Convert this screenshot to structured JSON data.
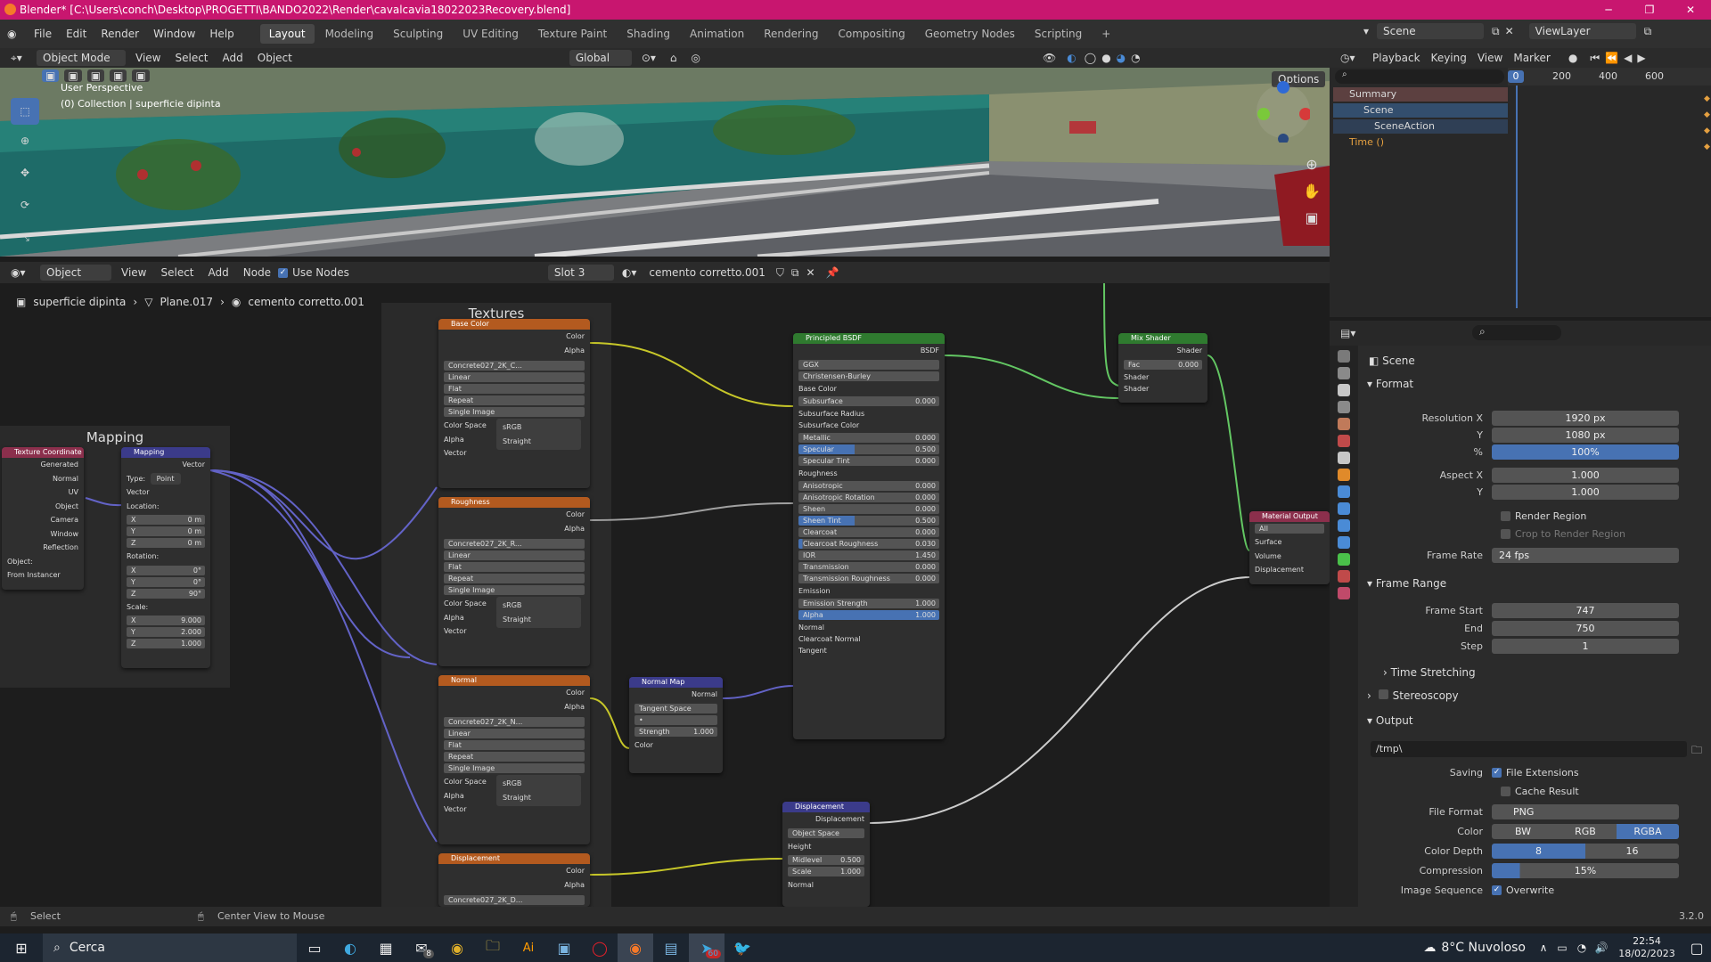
{
  "window": {
    "title": "Blender* [C:\\Users\\conch\\Desktop\\PROGETTI\\BANDO2022\\Render\\cavalcavia18022023Recovery.blend]"
  },
  "menu": {
    "items": [
      "File",
      "Edit",
      "Render",
      "Window",
      "Help"
    ],
    "workspaces": [
      "Layout",
      "Modeling",
      "Sculpting",
      "UV Editing",
      "Texture Paint",
      "Shading",
      "Animation",
      "Rendering",
      "Compositing",
      "Geometry Nodes",
      "Scripting"
    ],
    "scene": "Scene",
    "viewlayer": "ViewLayer"
  },
  "viewport": {
    "mode": "Object Mode",
    "menus": [
      "View",
      "Select",
      "Add",
      "Object"
    ],
    "orientation": "Global",
    "options": "Options",
    "overlay1": "User Perspective",
    "overlay2": "(0) Collection | superficie dipinta"
  },
  "timeline": {
    "menus": [
      "Playback",
      "Keying",
      "View",
      "Marker"
    ],
    "frame_current": "0",
    "ticks": [
      "200",
      "400",
      "600"
    ],
    "tree": [
      "Summary",
      "Scene",
      "SceneAction",
      "Time ()"
    ]
  },
  "node_editor": {
    "type": "Object",
    "menus": [
      "View",
      "Select",
      "Add",
      "Node"
    ],
    "use_nodes": "Use Nodes",
    "slot": "Slot 3",
    "material": "cemento corretto.001",
    "breadcrumb": [
      "superficie dipinta",
      "Plane.017",
      "cemento corretto.001"
    ],
    "frame_textures": "Textures",
    "frame_mapping": "Mapping"
  },
  "nodes": {
    "texcoord": {
      "title": "Texture Coordinate",
      "outputs": [
        "Generated",
        "Normal",
        "UV",
        "Object",
        "Camera",
        "Window",
        "Reflection"
      ],
      "object": "Object:",
      "instancer": "From Instancer"
    },
    "mapping": {
      "title": "Mapping",
      "out": "Vector",
      "type_lbl": "Type:",
      "type": "Point",
      "in": "Vector",
      "loc": "Location:",
      "rot": "Rotation:",
      "scale": "Scale:",
      "lx": "0 m",
      "ly": "0 m",
      "lz": "0 m",
      "rx": "0°",
      "ry": "0°",
      "rz": "90°",
      "sx": "9.000",
      "sy": "2.000",
      "sz": "1.000",
      "ax": "X",
      "ay": "Y",
      "az": "Z"
    },
    "tex": [
      {
        "title": "Base Color",
        "img": "Concrete027_2K_C...",
        "color": "#b35a1f"
      },
      {
        "title": "Roughness",
        "img": "Concrete027_2K_R...",
        "color": "#b35a1f"
      },
      {
        "title": "Normal",
        "img": "Concrete027_2K_N...",
        "color": "#b35a1f"
      },
      {
        "title": "Displacement",
        "img": "Concrete027_2K_D...",
        "color": "#b35a1f"
      }
    ],
    "tex_rows": {
      "color": "Color",
      "alpha": "Alpha",
      "interp": "Linear",
      "proj": "Flat",
      "ext": "Repeat",
      "src": "Single Image",
      "cs_lbl": "Color Space",
      "cs": "sRGB",
      "al_lbl": "Alpha",
      "al": "Straight",
      "vec": "Vector"
    },
    "bsdf": {
      "title": "Principled BSDF",
      "out": "BSDF",
      "dist": "GGX",
      "ss": "Christensen-Burley",
      "rows": [
        [
          "Base Color",
          ""
        ],
        [
          "Subsurface",
          "0.000"
        ],
        [
          "Subsurface Radius",
          ""
        ],
        [
          "Subsurface Color",
          ""
        ],
        [
          "Metallic",
          "0.000"
        ],
        [
          "Specular",
          "0.500"
        ],
        [
          "Specular Tint",
          "0.000"
        ],
        [
          "Roughness",
          ""
        ],
        [
          "Anisotropic",
          "0.000"
        ],
        [
          "Anisotropic Rotation",
          "0.000"
        ],
        [
          "Sheen",
          "0.000"
        ],
        [
          "Sheen Tint",
          "0.500"
        ],
        [
          "Clearcoat",
          "0.000"
        ],
        [
          "Clearcoat Roughness",
          "0.030"
        ],
        [
          "IOR",
          "1.450"
        ],
        [
          "Transmission",
          "0.000"
        ],
        [
          "Transmission Roughness",
          "0.000"
        ],
        [
          "Emission",
          ""
        ],
        [
          "Emission Strength",
          "1.000"
        ],
        [
          "Alpha",
          "1.000"
        ],
        [
          "Normal",
          ""
        ],
        [
          "Clearcoat Normal",
          ""
        ],
        [
          "Tangent",
          ""
        ]
      ]
    },
    "mix": {
      "title": "Mix Shader",
      "out": "Shader",
      "fac": "Fac",
      "facv": "0.000",
      "s1": "Shader",
      "s2": "Shader"
    },
    "out": {
      "title": "Material Output",
      "target": "All",
      "in": [
        "Surface",
        "Volume",
        "Displacement"
      ]
    },
    "nmap": {
      "title": "Normal Map",
      "out": "Normal",
      "space": "Tangent Space",
      "strength": "Strength",
      "strengthv": "1.000",
      "in": "Color"
    },
    "disp": {
      "title": "Displacement",
      "out": "Displacement",
      "space": "Object Space",
      "in": [
        "Height",
        "Midlevel",
        "Scale",
        "Normal"
      ],
      "mid": "0.500",
      "scale": "1.000"
    }
  },
  "props": {
    "scene": "Scene",
    "format": "Format",
    "resx_l": "Resolution X",
    "resx": "1920 px",
    "resy_l": "Y",
    "resy": "1080 px",
    "pct_l": "%",
    "pct": "100%",
    "aspx_l": "Aspect X",
    "aspx": "1.000",
    "aspy_l": "Y",
    "aspy": "1.000",
    "region": "Render Region",
    "crop": "Crop to Render Region",
    "fr_l": "Frame Rate",
    "fr": "24 fps",
    "frange": "Frame Range",
    "fs_l": "Frame Start",
    "fs": "747",
    "fe_l": "End",
    "fe": "750",
    "st_l": "Step",
    "st": "1",
    "tstretch": "Time Stretching",
    "stereo": "Stereoscopy",
    "output": "Output",
    "path": "/tmp\\",
    "saving": "Saving",
    "fileext": "File Extensions",
    "cache": "Cache Result",
    "ff_l": "File Format",
    "ff": "PNG",
    "col_l": "Color",
    "bw": "BW",
    "rgb": "RGB",
    "rgba": "RGBA",
    "cd_l": "Color Depth",
    "cd8": "8",
    "cd16": "16",
    "comp_l": "Compression",
    "comp": "15%",
    "seq_l": "Image Sequence",
    "overwrite": "Overwrite"
  },
  "status": {
    "left": "Select",
    "mid": "Center View to Mouse",
    "version": "3.2.0"
  },
  "taskbar": {
    "search": "Cerca",
    "weather": "8°C  Nuvoloso",
    "time": "22:54",
    "date": "18/02/2023",
    "mail_badge": "8",
    "tg_badge": "60"
  }
}
